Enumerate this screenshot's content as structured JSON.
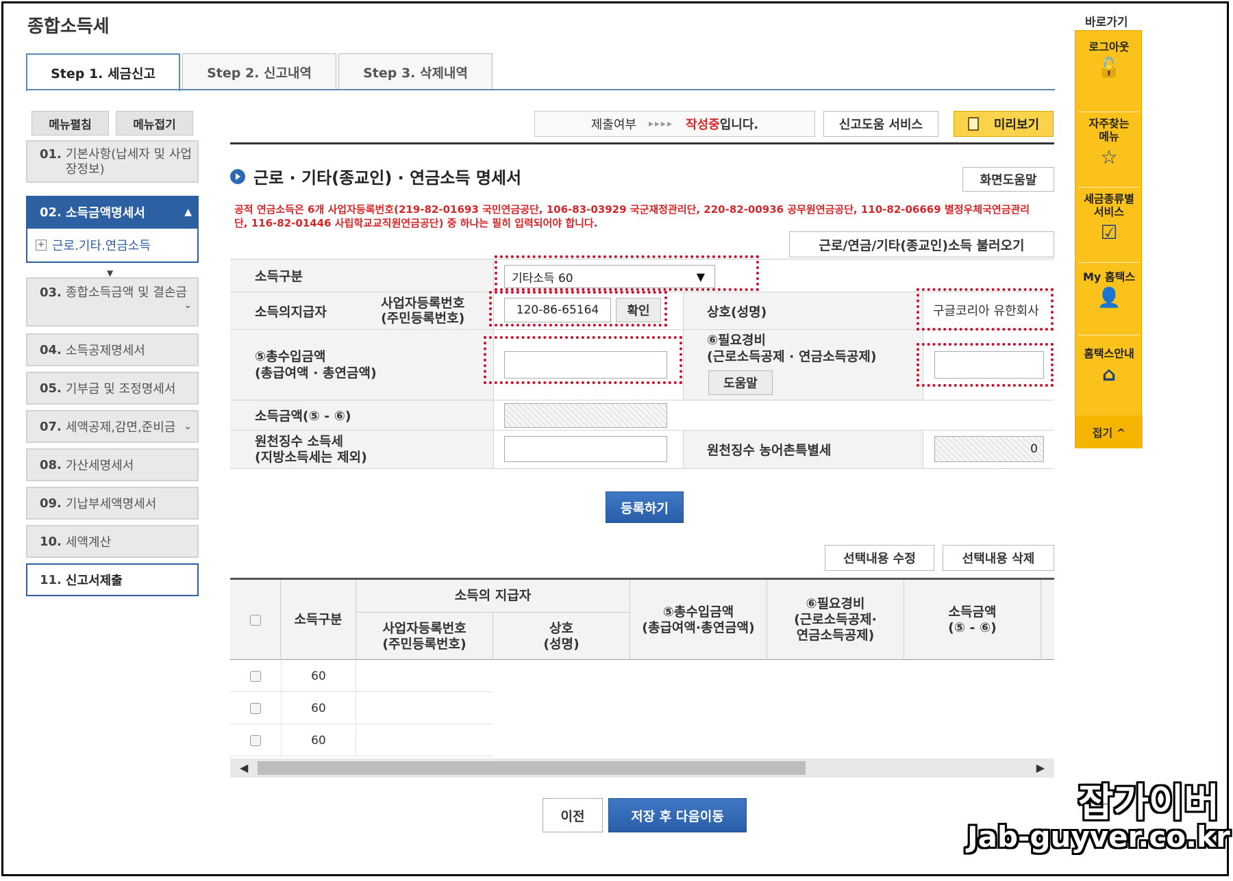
{
  "page": {
    "title": "종합소득세"
  },
  "tabs": [
    {
      "label": "Step 1. 세금신고",
      "active": true
    },
    {
      "label": "Step 2. 신고내역",
      "active": false
    },
    {
      "label": "Step 3. 삭제내역",
      "active": false
    }
  ],
  "sidebar": {
    "expand_label": "메뉴펼침",
    "collapse_label": "메뉴접기",
    "items": [
      {
        "num": "01.",
        "label": "기본사항(납세자 및 사업장정보)"
      },
      {
        "num": "02.",
        "label": "소득금액명세서"
      },
      {
        "num": "03.",
        "label": "종합소득금액 및 결손금"
      },
      {
        "num": "04.",
        "label": "소득공제명세서"
      },
      {
        "num": "05.",
        "label": "기부금 및 조정명세서"
      },
      {
        "num": "07.",
        "label": "세액공제,감면,준비금"
      },
      {
        "num": "08.",
        "label": "가산세명세서"
      },
      {
        "num": "09.",
        "label": "기납부세액명세서"
      },
      {
        "num": "10.",
        "label": "세액계산"
      },
      {
        "num": "11.",
        "label": "신고서제출"
      }
    ],
    "sub_item": "근로.기타.연금소득"
  },
  "status": {
    "label": "제출여부",
    "arrows": "▸▸▸▸",
    "value_highlight": "작성중",
    "value_rest": "입니다."
  },
  "toolbar": {
    "help_service": "신고도움 서비스",
    "preview": "미리보기",
    "screen_help": "화면도움말",
    "load_income": "근로/연금/기타(종교인)소득 불러오기"
  },
  "section": {
    "title": "근로 · 기타(종교인) · 연금소득 명세서",
    "notice": "공적 연금소득은 6개 사업자등록번호(219-82-01693 국민연금공단, 106-83-03929 국군재정관리단, 220-82-00936 공무원연금공단, 110-82-06669 별정우체국연금관리단, 116-82-01446 사립학교교직원연금공단) 중 하나는 필히 입력되어야 합니다."
  },
  "form": {
    "income_type_label": "소득구분",
    "income_type_value": "기타소득 60",
    "payer_label": "소득의지급자",
    "biz_no_label_1": "사업자등록번호",
    "biz_no_label_2": "(주민등록번호)",
    "biz_no_value": "120-86-65164",
    "confirm_label": "확인",
    "company_label": "상호(성명)",
    "company_value": "구글코리아 유한회사",
    "total_income_label_1": "⑤총수입금액",
    "total_income_label_2": "(총급여액 · 총연금액)",
    "total_income_value": "",
    "expense_label_1": "⑥필요경비",
    "expense_label_2": "(근로소득공제 · 연금소득공제)",
    "expense_help": "도움말",
    "expense_value": "",
    "income_amount_label": "소득금액(⑤ - ⑥)",
    "withholding_label_1": "원천징수 소득세",
    "withholding_label_2": "(지방소득세는 제외)",
    "withholding_value": "",
    "rural_tax_label": "원천징수 농어촌특별세",
    "rural_tax_value": "0",
    "register_label": "등록하기"
  },
  "list": {
    "edit_selected": "선택내용 수정",
    "delete_selected": "선택내용 삭제",
    "headers": {
      "income_type": "소득구분",
      "payer": "소득의 지급자",
      "biz_no_1": "사업자등록번호",
      "biz_no_2": "(주민등록번호)",
      "company_1": "상호",
      "company_2": "(성명)",
      "total_1": "⑤총수입금액",
      "total_2": "(총급여액·총연금액)",
      "expense_1": "⑥필요경비",
      "expense_2": "(근로소득공제·",
      "expense_3": "연금소득공제)",
      "income_1": "소득금액",
      "income_2": "(⑤ - ⑥)"
    },
    "rows": [
      {
        "income_type": "60"
      },
      {
        "income_type": "60"
      },
      {
        "income_type": "60"
      }
    ]
  },
  "nav": {
    "prev": "이전",
    "save_next": "저장 후 다음이동"
  },
  "quickbar": {
    "title": "바로가기",
    "items": [
      {
        "label": "로그아웃",
        "icon": "lock-icon"
      },
      {
        "label": "자주찾는 메뉴",
        "icon": "star-icon"
      },
      {
        "label": "세금종류별 서비스",
        "icon": "check-icon"
      },
      {
        "label": "My 홈택스",
        "icon": "user-icon"
      },
      {
        "label": "홈택스안내",
        "icon": "home-icon"
      }
    ],
    "fold_label": "접기 ^"
  },
  "watermark": {
    "korean": "잡가이버",
    "domain": "Jab-guyver.co.kr"
  },
  "colors": {
    "accent_blue": "#2d5fa3",
    "highlight_red": "#d6262a",
    "quickbar_yellow": "#fbc21c"
  }
}
